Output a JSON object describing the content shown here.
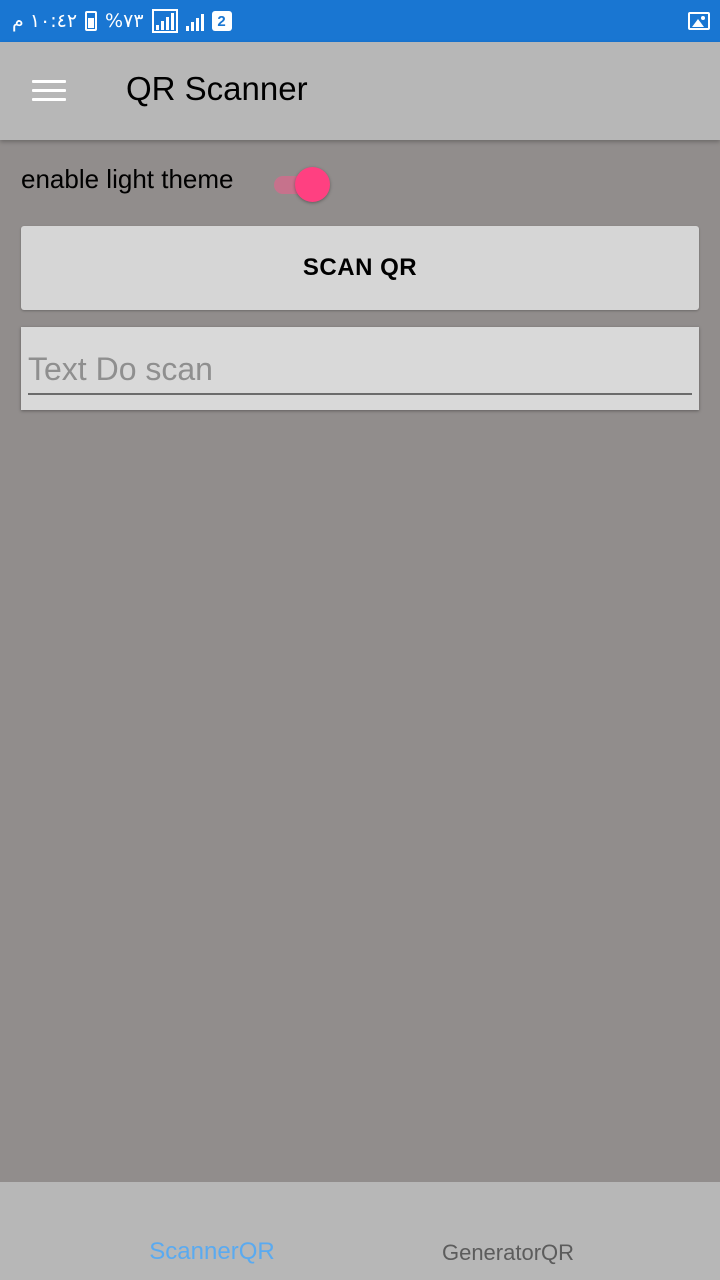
{
  "status_bar": {
    "time": "١٠:٤٢ م",
    "battery": "%٧٣",
    "sim_badge": "2"
  },
  "app_bar": {
    "title": "QR Scanner",
    "menu_icon": "hamburger-menu-icon"
  },
  "theme": {
    "label": "enable light theme",
    "enabled": true
  },
  "scan_button": {
    "label": "SCAN QR"
  },
  "scan_result": {
    "placeholder": "Text Do scan",
    "value": ""
  },
  "bottom_tabs": {
    "tabs": [
      {
        "label": "ScannerQR",
        "active": true
      },
      {
        "label": "GeneratorQR",
        "active": false
      }
    ]
  },
  "colors": {
    "status_bar": "#1976d2",
    "background": "#918d8c",
    "app_bar": "#b7b7b7",
    "accent": "#ff4081",
    "active_tab": "#5aaaf0"
  }
}
